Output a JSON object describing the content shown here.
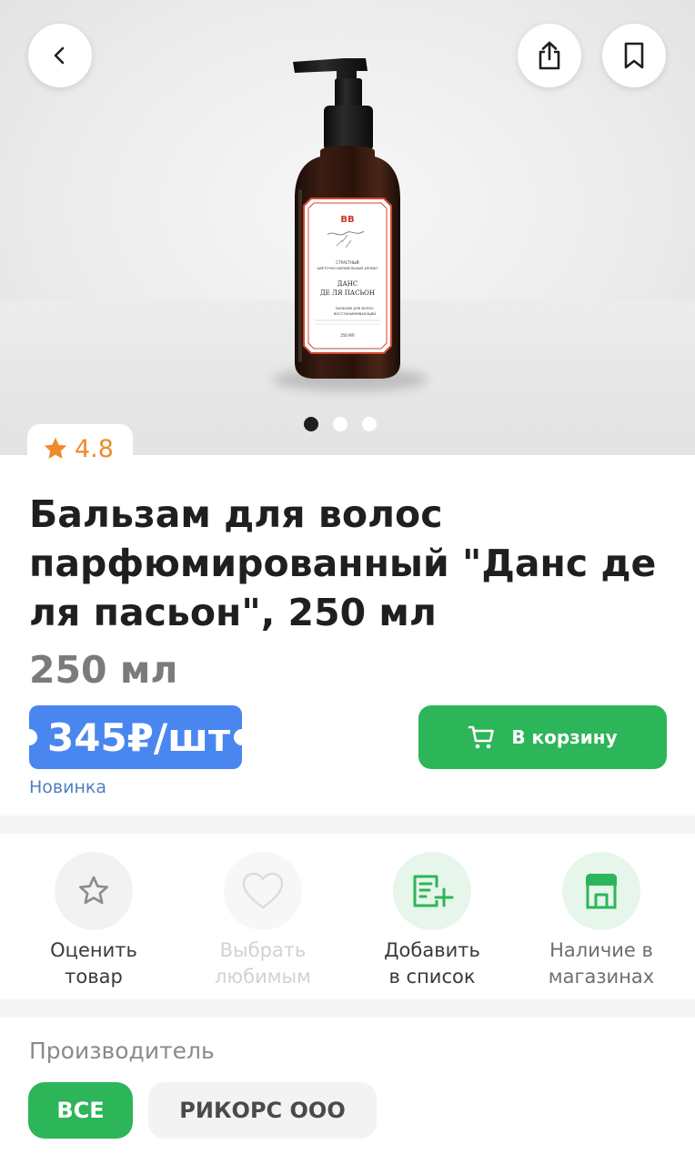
{
  "hero": {
    "gallery_total": 3,
    "gallery_active_index": 0
  },
  "rating": {
    "value": "4.8"
  },
  "product": {
    "title": "Бальзам для волос парфюмированный \"Данс де ля пасьон\", 250 мл",
    "volume": "250 мл",
    "price": "345₽/шт",
    "badge": "Новинка",
    "label_brand": "BB",
    "label_line1": "СТРАСТНЫЙ",
    "label_line2": "ЦВЕТОЧНО-КАРАМЕЛЬНЫЙ АРОМАТ",
    "label_name1": "ДАНС",
    "label_name2": "ДЕ ЛЯ ПАСЬОН",
    "label_type1": "БАЛЬЗАМ ДЛЯ ВОЛОС",
    "label_type2": "ВОССТАНАВЛИВАЮЩИЙ",
    "label_volume": "250 МЛ"
  },
  "cart": {
    "label": "В корзину"
  },
  "actions": [
    {
      "line1": "Оценить",
      "line2": "товар",
      "icon": "star-icon"
    },
    {
      "line1": "Выбрать",
      "line2": "любимым",
      "icon": "heart-icon"
    },
    {
      "line1": "Добавить",
      "line2": "в список",
      "icon": "add-list-icon"
    },
    {
      "line1": "Наличие в",
      "line2": "магазинах",
      "icon": "store-icon"
    }
  ],
  "manufacturer": {
    "title": "Производитель",
    "chips": [
      "ВСЕ",
      "РИКОРС ООО"
    ]
  },
  "colors": {
    "accent_green": "#2db559",
    "price_blue": "#4a86f0",
    "rating_orange": "#f08a2b",
    "badge_blue": "#4e7fc6"
  }
}
